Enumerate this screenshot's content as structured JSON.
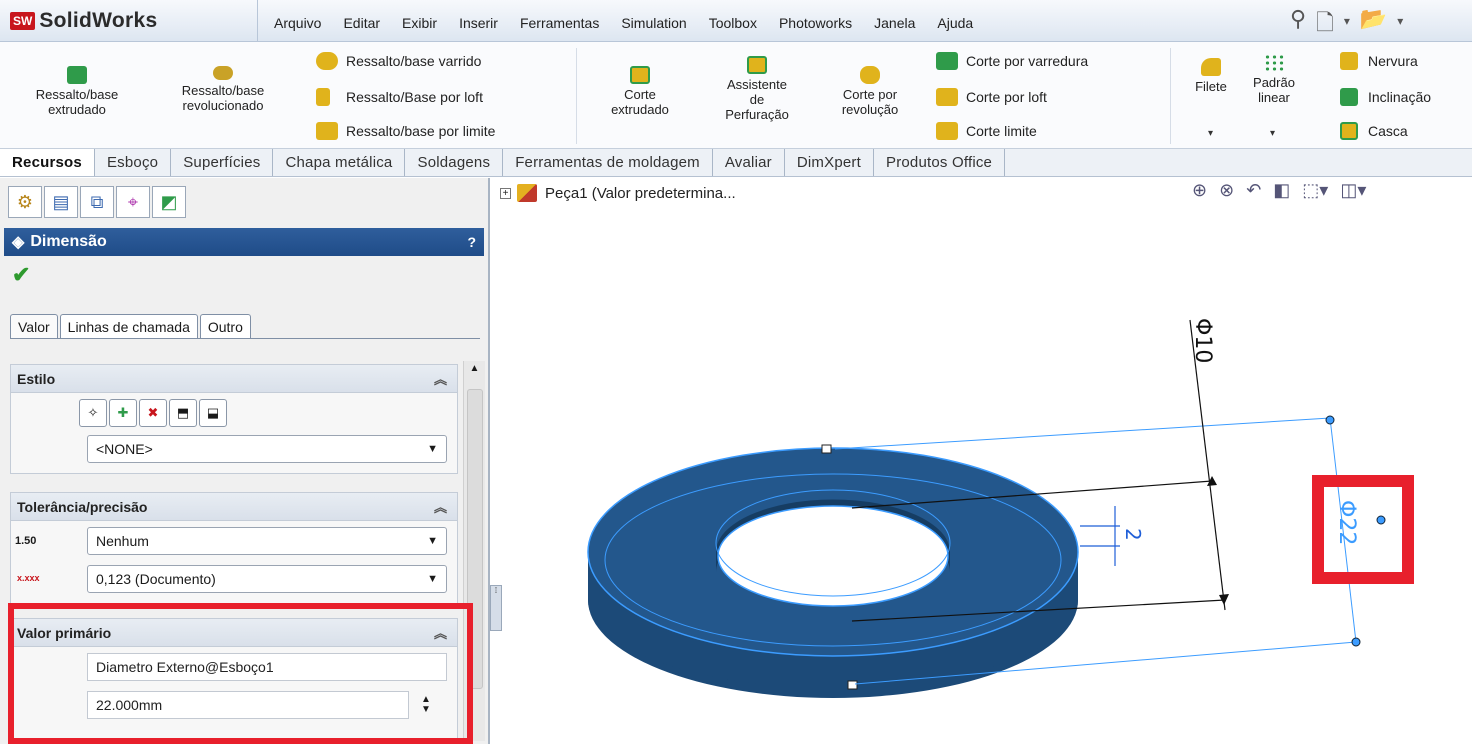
{
  "app": {
    "brand_short": "SW",
    "brand": "SolidWorks"
  },
  "menu": [
    "Arquivo",
    "Editar",
    "Exibir",
    "Inserir",
    "Ferramentas",
    "Simulation",
    "Toolbox",
    "Photoworks",
    "Janela",
    "Ajuda"
  ],
  "ribbon": {
    "extrude_l1": "Ressalto/base",
    "extrude_l2": "extrudado",
    "revolve_l1": "Ressalto/base",
    "revolve_l2": "revolucionado",
    "swept": "Ressalto/base varrido",
    "loft": "Ressalto/Base por loft",
    "boundary": "Ressalto/base por limite",
    "cut_l1": "Corte",
    "cut_l2": "extrudado",
    "hole_l1": "Assistente",
    "hole_l2": "de",
    "hole_l3": "Perfuração",
    "cutrev_l1": "Corte por",
    "cutrev_l2": "revolução",
    "cut_sweep": "Corte por varredura",
    "cut_loft": "Corte por loft",
    "cut_boundary": "Corte limite",
    "fillet": "Filete",
    "pattern_l1": "Padrão",
    "pattern_l2": "linear",
    "rib": "Nervura",
    "draft": "Inclinação",
    "shell": "Casca"
  },
  "cm_tabs": [
    "Recursos",
    "Esboço",
    "Superfícies",
    "Chapa metálica",
    "Soldagens",
    "Ferramentas de moldagem",
    "Avaliar",
    "DimXpert",
    "Produtos Office"
  ],
  "panel": {
    "title": "Dimensão",
    "help": "?",
    "tabs": [
      "Valor",
      "Linhas de chamada",
      "Outro"
    ],
    "style": {
      "title": "Estilo",
      "selected": "<NONE>"
    },
    "tolerance": {
      "title": "Tolerância/precisão",
      "tol_icon": "1.50",
      "tol_value": "Nenhum",
      "prec_icon": "x.xxx",
      "prec_value": "0,123 (Documento)"
    },
    "primary": {
      "title": "Valor primário",
      "name": "Diametro Externo@Esboço1",
      "value": "22.000mm"
    }
  },
  "tree": {
    "label": "Peça1  (Valor predetermina..."
  },
  "dims": {
    "d10": "Φ10",
    "d22": "Φ22",
    "d2": "2"
  },
  "colors": {
    "part_fill": "#23578c",
    "highlight": "#3c9cff",
    "annotation_red": "#e8202c"
  }
}
